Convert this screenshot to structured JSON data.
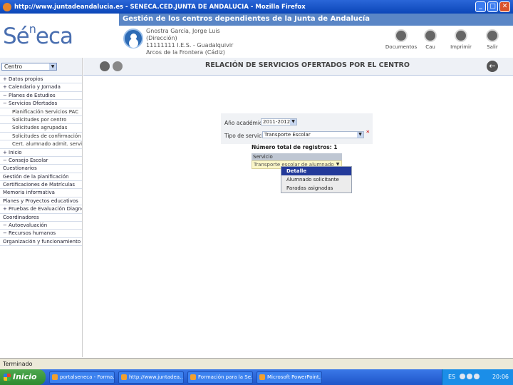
{
  "window": {
    "title": "http://www.juntadeandalucia.es - SENECA.CED.JUNTA DE ANDALUCIA - Mozilla Firefox",
    "min": "_",
    "max": "□",
    "close": "✕"
  },
  "header": {
    "app_title": "Gestión de los centros dependientes de la Junta de Andalucía",
    "logo": {
      "main": "Sé",
      "sup": "n",
      "rest": "eca"
    },
    "user_lines": [
      "Gnostra García, Jorge Luis",
      "(Dirección)",
      "11111111 I.E.S. - Guadalquivir",
      "Arcos de la Frontera (Cádiz)"
    ],
    "buttons": [
      "Documentos",
      "Cau",
      "Imprimir",
      "Salir"
    ]
  },
  "sidebar": {
    "centro_label": "Centro",
    "items": [
      {
        "sym": "+",
        "label": "Datos propios",
        "level": 0
      },
      {
        "sym": "+",
        "label": "Calendario y Jornada",
        "level": 0
      },
      {
        "sym": "-",
        "label": "Planes de Estudios",
        "level": 0
      },
      {
        "sym": "-",
        "label": "Servicios Ofertados",
        "level": 0
      },
      {
        "sym": "",
        "label": "Planificación Servicios PAC",
        "level": 1
      },
      {
        "sym": "",
        "label": "Solicitudes por centro",
        "level": 1
      },
      {
        "sym": "",
        "label": "Solicitudes agrupadas",
        "level": 1
      },
      {
        "sym": "",
        "label": "Solicitudes de confirmación y baja",
        "level": 1
      },
      {
        "sym": "",
        "label": "Cert. alumnado admit. servicio",
        "level": 1
      },
      {
        "sym": "+",
        "label": "Inicio",
        "level": 0
      },
      {
        "sym": "-",
        "label": "Consejo Escolar",
        "level": 0
      },
      {
        "sym": "",
        "label": "Cuestionarios",
        "level": 0
      },
      {
        "sym": "",
        "label": "Gestión de la planificación",
        "level": 0
      },
      {
        "sym": "",
        "label": "Certificaciones de Matrículas",
        "level": 0
      },
      {
        "sym": "",
        "label": "Memoria informativa",
        "level": 0
      },
      {
        "sym": "",
        "label": "Planes y Proyectos educativos",
        "level": 0
      },
      {
        "sym": "+",
        "label": "Pruebas de Evaluación Diagnóstico",
        "level": 0
      },
      {
        "sym": "",
        "label": "Coordinadores",
        "level": 0
      },
      {
        "sym": "-",
        "label": "Autoevaluación",
        "level": 0
      },
      {
        "sym": "-",
        "label": "Recursos humanos",
        "level": 0
      },
      {
        "sym": "",
        "label": "Organización y funcionamiento del centro",
        "level": 0
      }
    ]
  },
  "main": {
    "title": "RELACIÓN DE SERVICIOS OFERTADOS POR EL CENTRO",
    "form": {
      "year_label": "Año académico:",
      "year_value": "2011-2012",
      "type_label": "Tipo de servicio:",
      "type_value": "Transporte Escolar"
    },
    "count_label": "Número total de registros: 1",
    "grid": {
      "header": "Servicio",
      "row": "Transporte escolar de alumnado"
    },
    "context_menu": [
      "Detalle",
      "Alumnado solicitante",
      "Paradas asignadas"
    ]
  },
  "statusbar": {
    "text": "Terminado"
  },
  "taskbar": {
    "start": "Inicio",
    "tasks": [
      "portalseneca - Forma...",
      "http://www.juntadea...",
      "Formación para la Se...",
      "Microsoft PowerPoint..."
    ],
    "lang": "ES",
    "time": "20:06"
  }
}
